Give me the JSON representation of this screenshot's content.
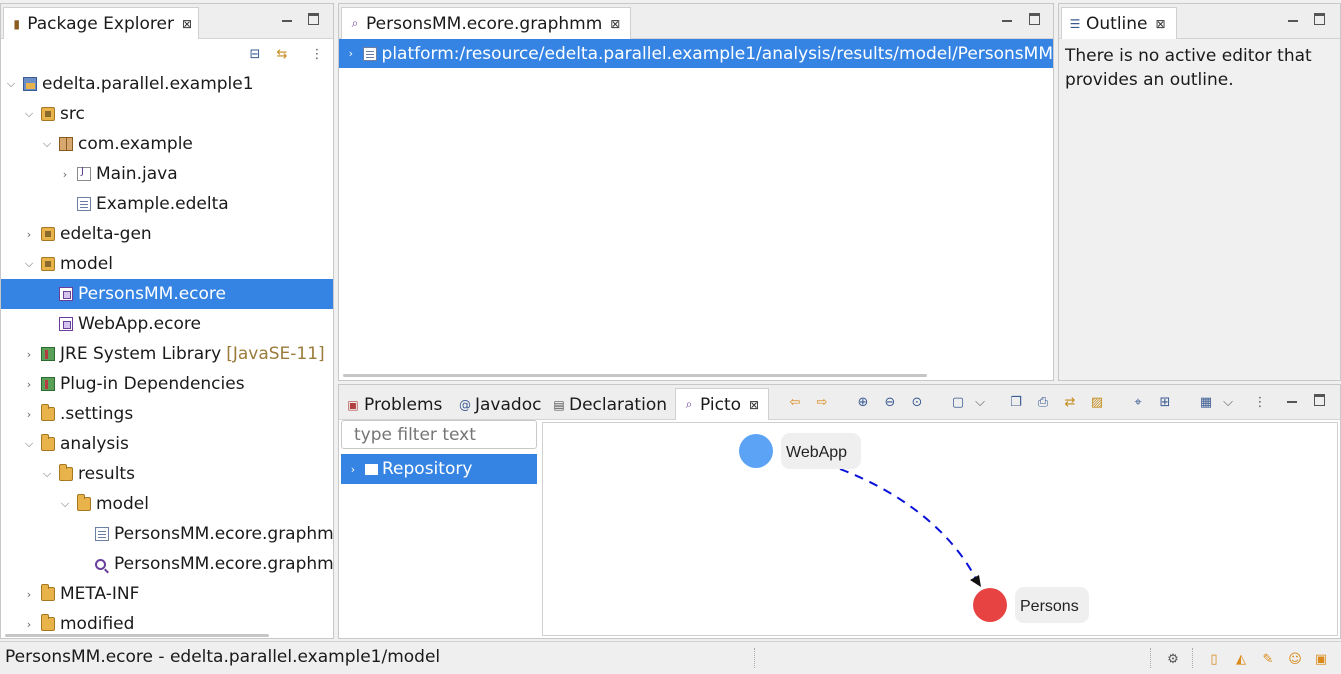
{
  "package_explorer": {
    "tab_label": "Package Explorer",
    "items": [
      {
        "label": "edelta.parallel.example1",
        "icon": "project-icon",
        "expanded": true
      },
      {
        "label": "src",
        "icon": "source-folder-icon",
        "expanded": true
      },
      {
        "label": "com.example",
        "icon": "package-icon",
        "expanded": true
      },
      {
        "label": "Main.java",
        "icon": "java-file-icon",
        "expanded": false
      },
      {
        "label": "Example.edelta",
        "icon": "file-icon"
      },
      {
        "label": "edelta-gen",
        "icon": "source-folder-icon",
        "expanded": false
      },
      {
        "label": "model",
        "icon": "source-folder-icon",
        "expanded": true
      },
      {
        "label": "PersonsMM.ecore",
        "icon": "ecore-file-icon",
        "selected": true
      },
      {
        "label": "WebApp.ecore",
        "icon": "ecore-file-icon"
      },
      {
        "label": "JRE System Library",
        "suffix": "[JavaSE-11]",
        "icon": "library-icon",
        "expanded": false
      },
      {
        "label": "Plug-in Dependencies",
        "icon": "library-icon",
        "expanded": false
      },
      {
        "label": ".settings",
        "icon": "folder-icon",
        "expanded": false
      },
      {
        "label": "analysis",
        "icon": "folder-icon",
        "expanded": true
      },
      {
        "label": "results",
        "icon": "folder-icon",
        "expanded": true
      },
      {
        "label": "model",
        "icon": "folder-icon",
        "expanded": true
      },
      {
        "label": "PersonsMM.ecore.graphm",
        "icon": "file-icon"
      },
      {
        "label": "PersonsMM.ecore.graphm",
        "icon": "picto-file-icon"
      },
      {
        "label": "META-INF",
        "icon": "folder-icon",
        "expanded": false
      },
      {
        "label": "modified",
        "icon": "folder-icon",
        "expanded": false
      }
    ]
  },
  "editor": {
    "tab_label": "PersonsMM.ecore.graphmm",
    "resource_row": "platform:/resource/edelta.parallel.example1/analysis/results/model/PersonsMM"
  },
  "outline": {
    "tab_label": "Outline",
    "message": "There is no active editor that provides an outline."
  },
  "bottom_tabs": {
    "problems": "Problems",
    "javadoc": "Javadoc",
    "declaration": "Declaration",
    "picto": "Picto"
  },
  "picto": {
    "filter_placeholder": "type filter text",
    "tree_item": "Repository",
    "nodes": [
      {
        "label": "WebApp",
        "color": "#5ca3f5"
      },
      {
        "label": "Persons",
        "color": "#e84343"
      }
    ],
    "edge_color": "#0a12d8"
  },
  "status": {
    "text": "PersonsMM.ecore - edelta.parallel.example1/model"
  },
  "colors": {
    "selection": "#3584e4"
  }
}
